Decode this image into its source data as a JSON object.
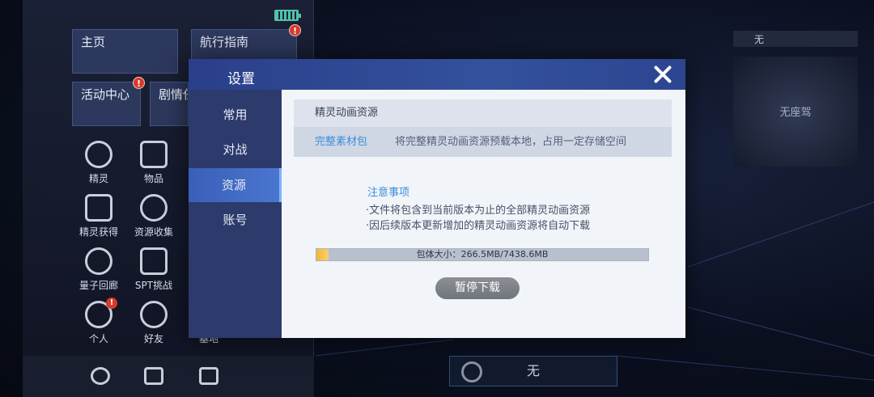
{
  "left_menu": {
    "tiles": [
      {
        "label": "主页",
        "alert": false
      },
      {
        "label": "航行指南",
        "alert": true
      },
      {
        "label": "活动中心",
        "alert": true
      },
      {
        "label": "剧情任",
        "alert": false
      }
    ],
    "grid": [
      {
        "label": "精灵",
        "icon": "elf-icon",
        "alert": false
      },
      {
        "label": "物品",
        "icon": "item-icon",
        "alert": false
      },
      {
        "label": "精灵获得",
        "icon": "crossed-swords-icon",
        "alert": false
      },
      {
        "label": "资源收集",
        "icon": "resource-icon",
        "alert": false
      },
      {
        "label": "量子回廊",
        "icon": "spiral-icon",
        "alert": false
      },
      {
        "label": "SPT挑战",
        "icon": "shield-icon",
        "alert": false
      },
      {
        "label": "个人",
        "icon": "profile-icon",
        "alert": true
      },
      {
        "label": "好友",
        "icon": "friends-icon",
        "alert": false
      },
      {
        "label": "基地",
        "icon": "base-icon",
        "alert": false
      }
    ],
    "alert_mark": "!"
  },
  "right_panel": {
    "label_none": "无",
    "card_text": "无座驾"
  },
  "bottom_center": {
    "label": "无"
  },
  "dialog": {
    "title": "设置",
    "tabs": [
      {
        "label": "常用",
        "active": false
      },
      {
        "label": "对战",
        "active": false
      },
      {
        "label": "资源",
        "active": true
      },
      {
        "label": "账号",
        "active": false
      }
    ],
    "section_title": "精灵动画资源",
    "option_label": "完整素材包",
    "option_desc": "将完整精灵动画资源预载本地，占用一定存储空间",
    "notice_title": "注意事项",
    "notice_lines": [
      "·文件将包含到当前版本为止的全部精灵动画资源",
      "·因后续版本更新增加的精灵动画资源将自动下载"
    ],
    "progress_text": "包体大小：266.5MB/7438.6MB",
    "progress_fraction": 0.0358,
    "pause_label": "暂停下载"
  },
  "colors": {
    "accent_blue": "#3a8fd8",
    "header_blue": "#2a3f8a",
    "progress_fill": "#f2b53a",
    "alert_red": "#d63a2c"
  }
}
